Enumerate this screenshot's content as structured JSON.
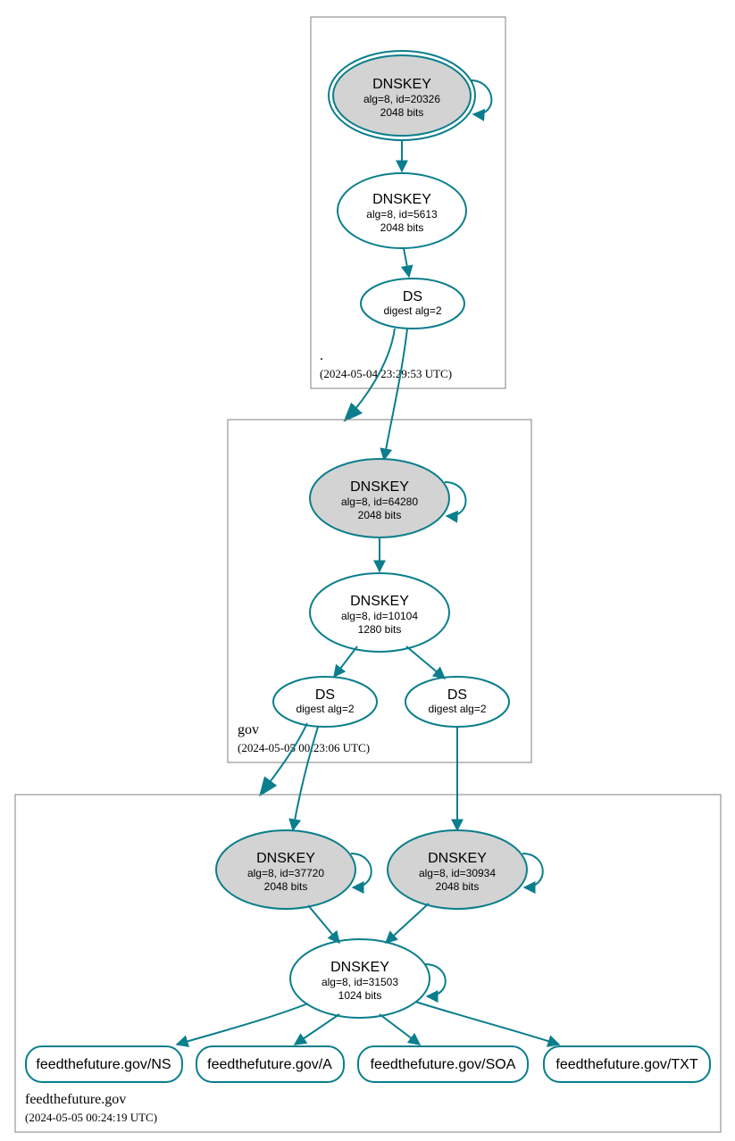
{
  "color": "#0a7e8c",
  "zones": {
    "root": {
      "name": ".",
      "time": "(2024-05-04 23:29:53 UTC)"
    },
    "gov": {
      "name": "gov",
      "time": "(2024-05-05 00:23:06 UTC)"
    },
    "ftf": {
      "name": "feedthefuture.gov",
      "time": "(2024-05-05 00:24:19 UTC)"
    }
  },
  "nodes": {
    "root_ksk": {
      "title": "DNSKEY",
      "l1": "alg=8, id=20326",
      "l2": "2048 bits"
    },
    "root_zsk": {
      "title": "DNSKEY",
      "l1": "alg=8, id=5613",
      "l2": "2048 bits"
    },
    "root_ds": {
      "title": "DS",
      "l1": "digest alg=2",
      "l2": ""
    },
    "gov_ksk": {
      "title": "DNSKEY",
      "l1": "alg=8, id=64280",
      "l2": "2048 bits"
    },
    "gov_zsk": {
      "title": "DNSKEY",
      "l1": "alg=8, id=10104",
      "l2": "1280 bits"
    },
    "gov_ds1": {
      "title": "DS",
      "l1": "digest alg=2",
      "l2": ""
    },
    "gov_ds2": {
      "title": "DS",
      "l1": "digest alg=2",
      "l2": ""
    },
    "ftf_ksk1": {
      "title": "DNSKEY",
      "l1": "alg=8, id=37720",
      "l2": "2048 bits"
    },
    "ftf_ksk2": {
      "title": "DNSKEY",
      "l1": "alg=8, id=30934",
      "l2": "2048 bits"
    },
    "ftf_zsk": {
      "title": "DNSKEY",
      "l1": "alg=8, id=31503",
      "l2": "1024 bits"
    }
  },
  "rr": {
    "ns": "feedthefuture.gov/NS",
    "a": "feedthefuture.gov/A",
    "soa": "feedthefuture.gov/SOA",
    "txt": "feedthefuture.gov/TXT"
  }
}
